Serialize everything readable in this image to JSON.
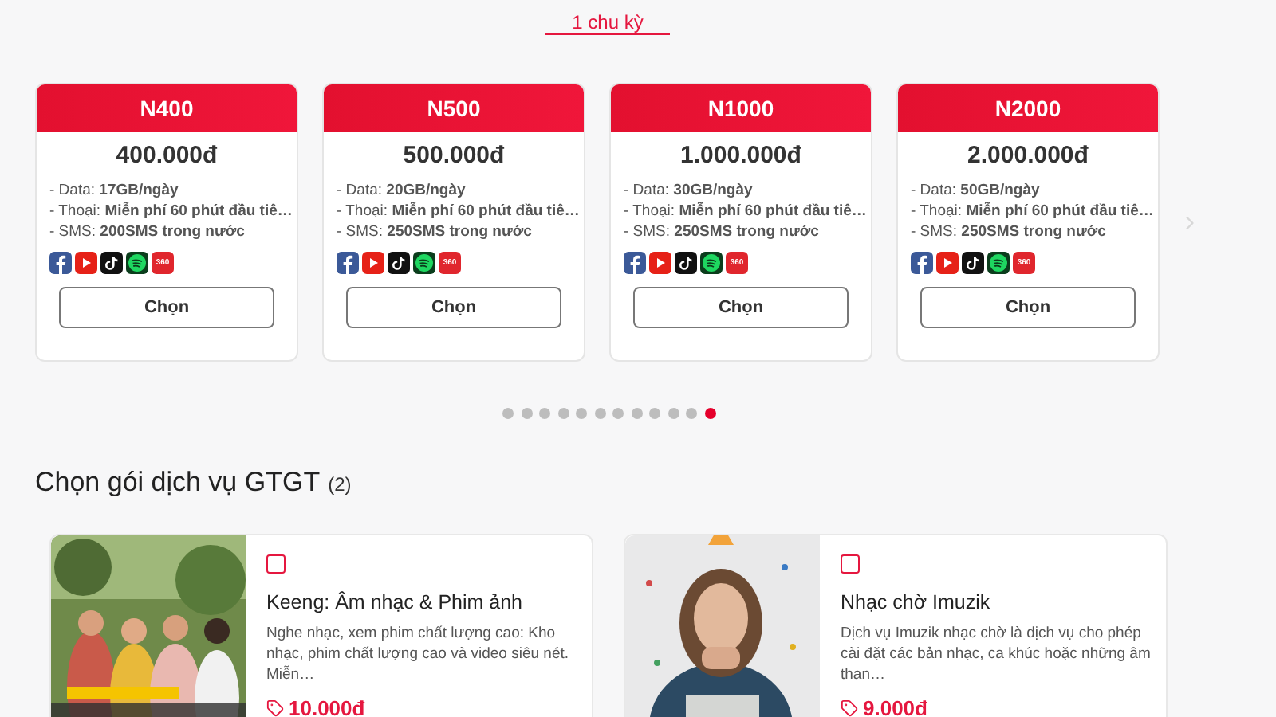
{
  "tabs": [
    {
      "label": "1 chu kỳ",
      "selected": true
    }
  ],
  "packages": [
    {
      "name": "N400",
      "price": "400.000đ",
      "features": [
        "- Data: **17GB/ngày**",
        "- Thoại: **Miễn phí 60 phút đầu tiê…**",
        "- SMS: **200SMS trong nước**"
      ],
      "apps": [
        {
          "kind": "facebook"
        },
        {
          "kind": "youtube"
        },
        {
          "kind": "tiktok"
        },
        {
          "kind": "spotify"
        },
        {
          "kind": "tv360",
          "label": "360"
        }
      ],
      "button": "Chọn"
    },
    {
      "name": "N500",
      "price": "500.000đ",
      "features": [
        "- Data: **20GB/ngày**",
        "- Thoại: **Miễn phí 60 phút đầu tiê…**",
        "- SMS: **250SMS trong nước**"
      ],
      "apps": [
        {
          "kind": "facebook"
        },
        {
          "kind": "youtube"
        },
        {
          "kind": "tiktok"
        },
        {
          "kind": "spotify"
        },
        {
          "kind": "tv360",
          "label": "360"
        }
      ],
      "button": "Chọn"
    },
    {
      "name": "N1000",
      "price": "1.000.000đ",
      "features": [
        "- Data: **30GB/ngày**",
        "- Thoại: **Miễn phí 60 phút đầu tiê…**",
        "- SMS: **250SMS trong nước**"
      ],
      "apps": [
        {
          "kind": "facebook"
        },
        {
          "kind": "youtube"
        },
        {
          "kind": "tiktok"
        },
        {
          "kind": "spotify"
        },
        {
          "kind": "tv360",
          "label": "360"
        }
      ],
      "button": "Chọn"
    },
    {
      "name": "N2000",
      "price": "2.000.000đ",
      "features": [
        "- Data: **50GB/ngày**",
        "- Thoại: **Miễn phí 60 phút đầu tiê…**",
        "- SMS: **250SMS trong nước**"
      ],
      "apps": [
        {
          "kind": "facebook"
        },
        {
          "kind": "youtube"
        },
        {
          "kind": "tiktok"
        },
        {
          "kind": "spotify"
        },
        {
          "kind": "tv360",
          "label": "360"
        }
      ],
      "button": "Chọn"
    }
  ],
  "pagination": [
    {
      "selected": false
    },
    {
      "selected": false
    },
    {
      "selected": false
    },
    {
      "selected": false
    },
    {
      "selected": false
    },
    {
      "selected": false
    },
    {
      "selected": false
    },
    {
      "selected": false
    },
    {
      "selected": false
    },
    {
      "selected": false
    },
    {
      "selected": false
    },
    {
      "selected": true
    }
  ],
  "services_section": {
    "title": "Chọn gói dịch vụ GTGT",
    "count": "(2)"
  },
  "services": [
    {
      "kind": "picture",
      "checked": false,
      "title": "Keeng: Âm nhạc & Phim ảnh",
      "description": "Nghe nhạc, xem phim chất lượng cao: Kho nhạc, phim chất lượng cao và video siêu nét. Miễn…",
      "price": "10.000đ"
    },
    {
      "kind": "picture",
      "checked": false,
      "title": "Nhạc chờ Imuzik",
      "description": "Dịch vụ Imuzik nhạc chờ là dịch vụ cho phép cài đặt các bản nhạc, ca khúc hoặc những âm than…",
      "price": "9.000đ"
    }
  ]
}
